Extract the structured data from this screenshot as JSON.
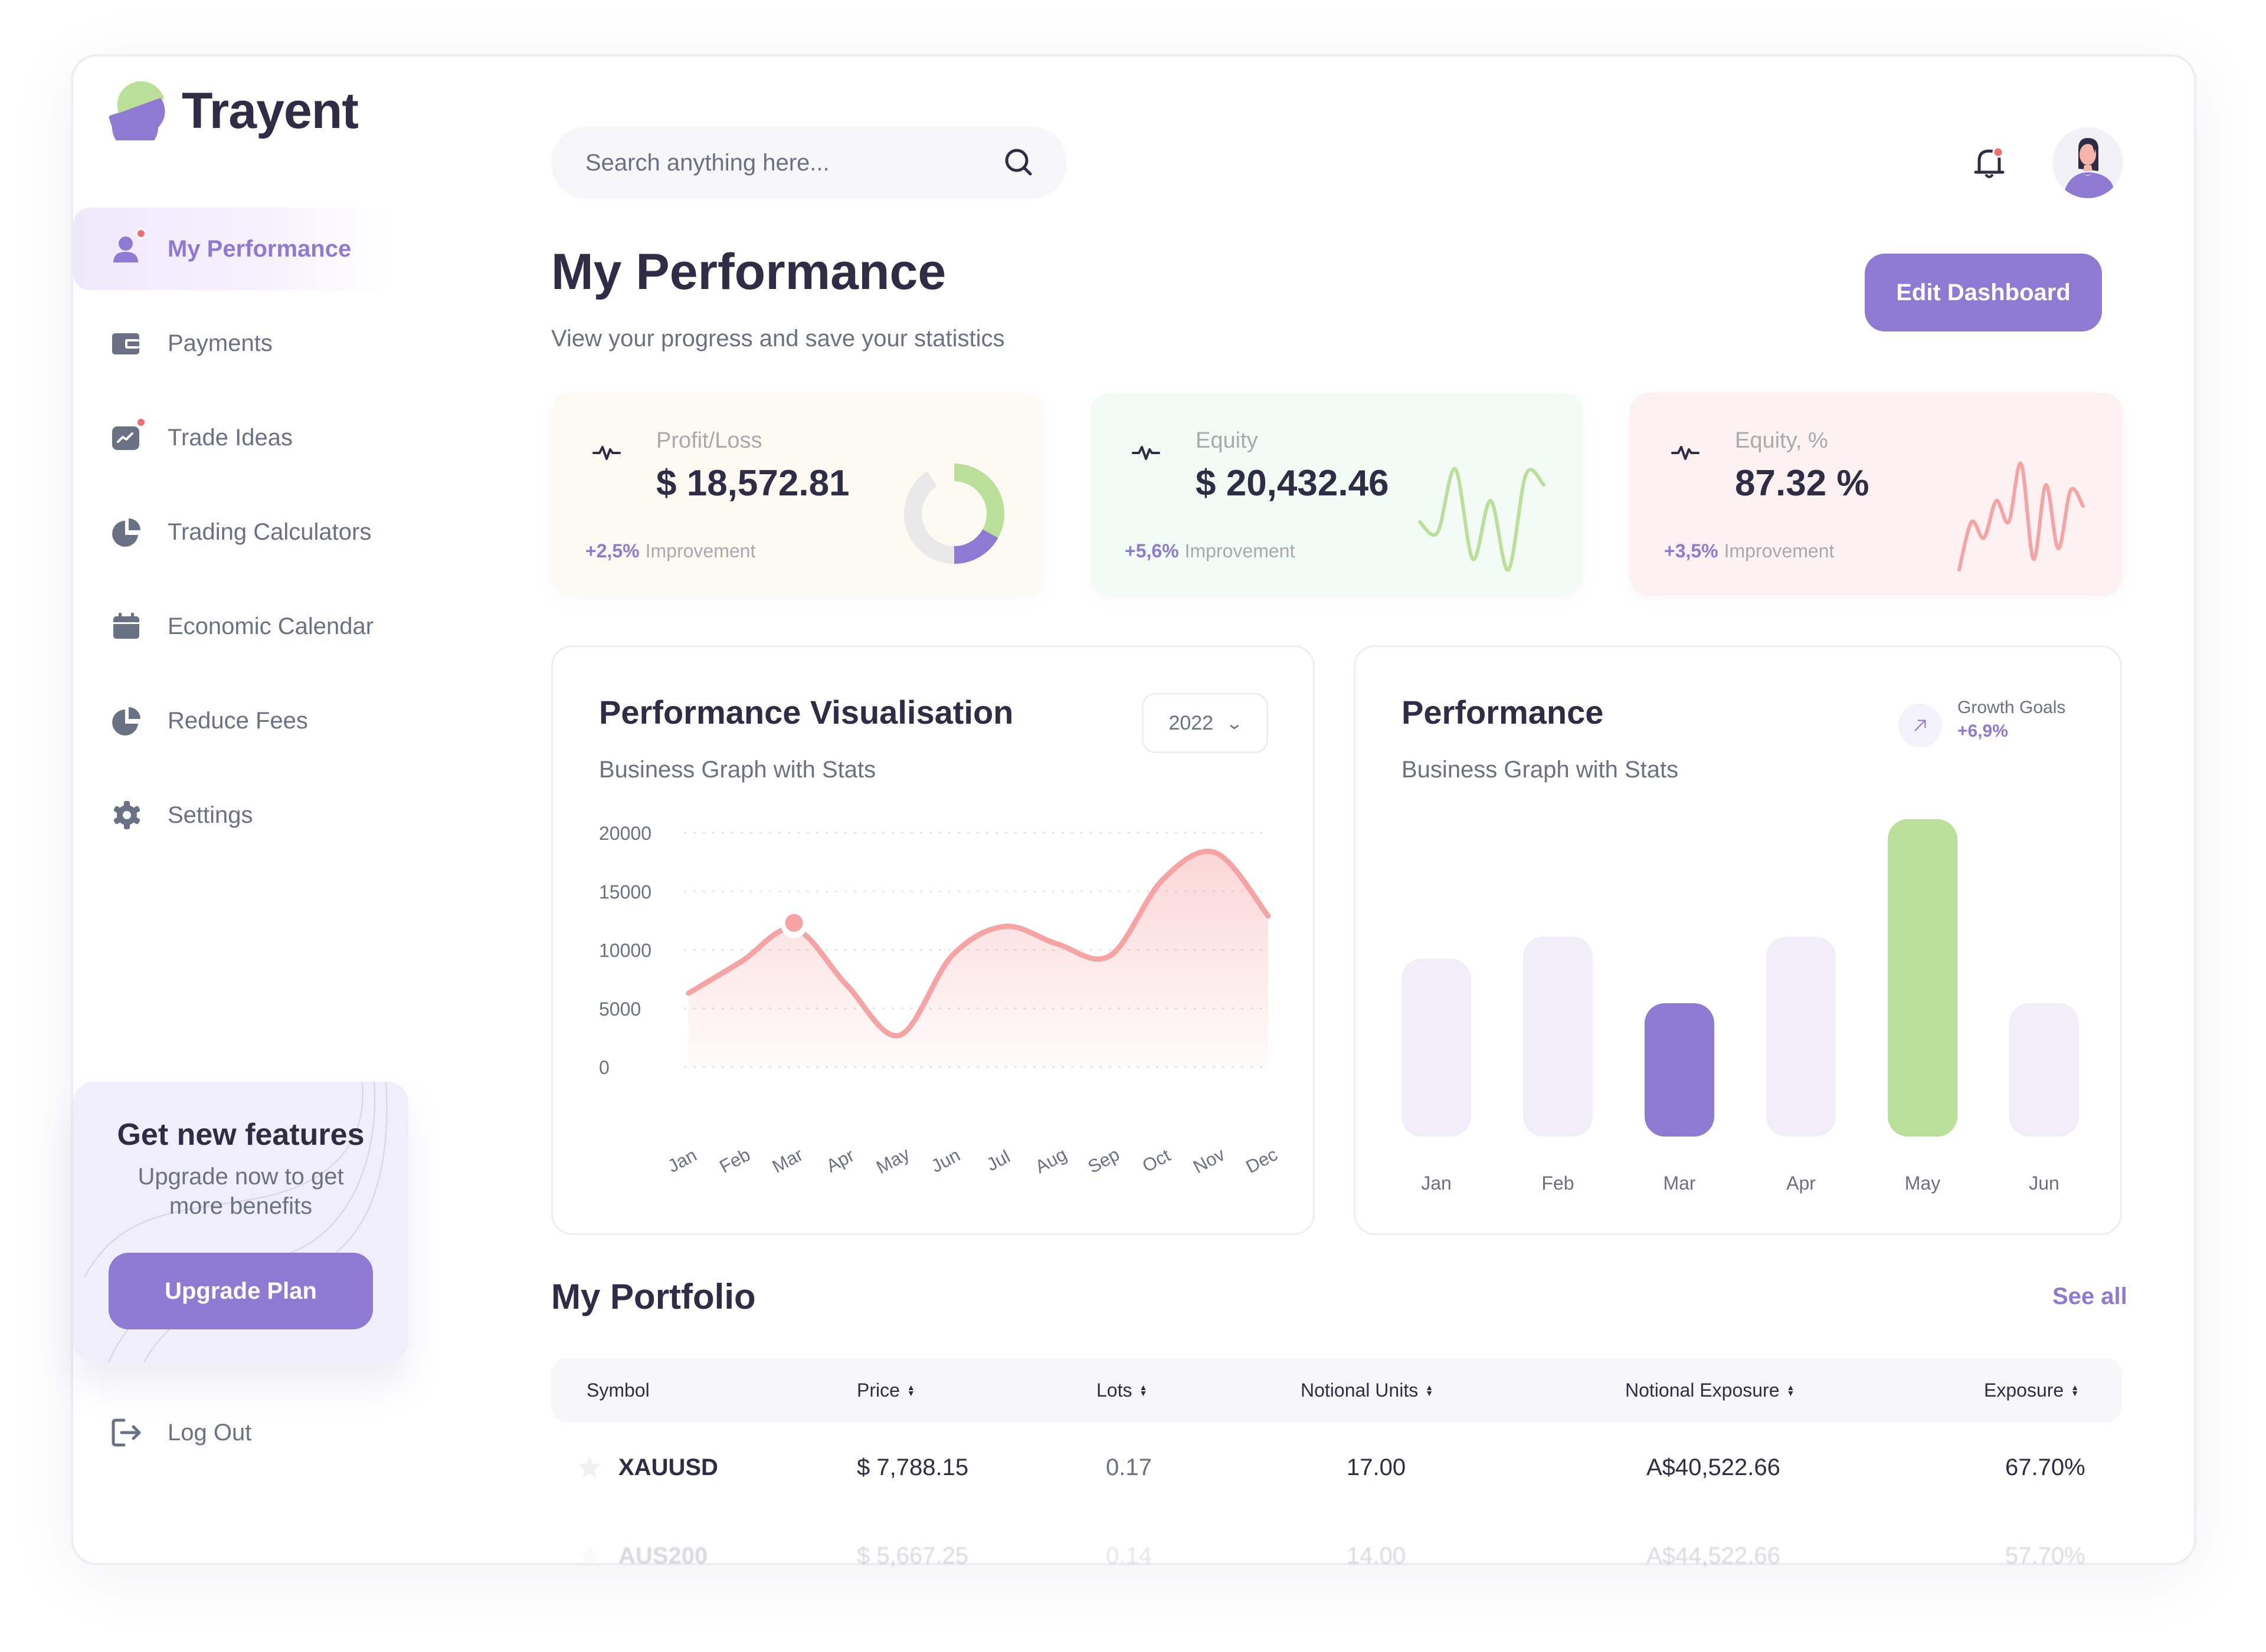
{
  "app": {
    "name": "Trayent"
  },
  "sidebar": {
    "items": [
      {
        "label": "My Performance",
        "icon": "user-icon",
        "active": true,
        "badge": true
      },
      {
        "label": "Payments",
        "icon": "wallet-icon",
        "active": false,
        "badge": false
      },
      {
        "label": "Trade Ideas",
        "icon": "chart-icon",
        "active": false,
        "badge": true
      },
      {
        "label": "Trading Calculators",
        "icon": "pie-chart-icon",
        "active": false,
        "badge": false
      },
      {
        "label": "Economic Calendar",
        "icon": "calendar-icon",
        "active": false,
        "badge": false
      },
      {
        "label": "Reduce Fees",
        "icon": "pie-chart-icon",
        "active": false,
        "badge": false
      },
      {
        "label": "Settings",
        "icon": "gear-icon",
        "active": false,
        "badge": false
      }
    ],
    "promo": {
      "title": "Get new features",
      "subtitle": "Upgrade now to get more benefits",
      "button": "Upgrade Plan"
    },
    "logout": "Log Out"
  },
  "header": {
    "search_placeholder": "Search anything here...",
    "search_value": "",
    "notifications_badge": true
  },
  "page": {
    "title": "My Performance",
    "subtitle": "View your progress and save your statistics",
    "edit_button": "Edit Dashboard"
  },
  "stats": [
    {
      "label": "Profit/Loss",
      "value": "$ 18,572.81",
      "delta": "+2,5%",
      "delta_label": "Improvement",
      "graph": "donut",
      "donut_fractions": {
        "green": 0.42,
        "purple": 0.17,
        "gray": 0.41
      }
    },
    {
      "label": "Equity",
      "value": "$ 20,432.46",
      "delta": "+5,6%",
      "delta_label": "Improvement",
      "graph": "sparkline",
      "color": "#b9df98",
      "spark": [
        0.45,
        0.35,
        0.95,
        0.1,
        0.65,
        0.0,
        0.9,
        0.8
      ]
    },
    {
      "label": "Equity, %",
      "value": "87.32 %",
      "delta": "+3,5%",
      "delta_label": "Improvement",
      "graph": "sparkline",
      "color": "#f6a3a3",
      "spark": [
        0.0,
        0.45,
        0.3,
        0.65,
        0.45,
        1.0,
        0.1,
        0.8,
        0.2,
        0.75,
        0.6
      ]
    }
  ],
  "colors": {
    "accent": "#8e7ad2",
    "green": "#b9df98",
    "pink": "#f6a3a3",
    "dark": "#2f2c45",
    "muted": "#6b7184",
    "bar_light": "#f1eefa"
  },
  "performance_visualisation": {
    "title": "Performance Visualisation",
    "subtitle": "Business Graph with Stats",
    "year_selected": "2022"
  },
  "performance_bars": {
    "title": "Performance",
    "subtitle": "Business Graph with Stats",
    "growth_label": "Growth Goals",
    "growth_value": "+6,9%"
  },
  "chart_data": [
    {
      "type": "area",
      "title": "Performance Visualisation",
      "subtitle": "Business Graph with Stats",
      "categories": [
        "Jan",
        "Feb",
        "Mar",
        "Apr",
        "May",
        "Jun",
        "Jul",
        "Aug",
        "Sep",
        "Oct",
        "Nov",
        "Dec"
      ],
      "values": [
        6300,
        9000,
        11800,
        7000,
        2700,
        9500,
        12000,
        10500,
        9500,
        16000,
        18300,
        12900
      ],
      "highlight_index": 2,
      "yticks": [
        0,
        5000,
        10000,
        15000,
        20000
      ],
      "ylim": [
        0,
        20000
      ],
      "xlabel": "",
      "ylabel": "",
      "grid": true,
      "color": "#f6a3a3"
    },
    {
      "type": "bar",
      "title": "Performance",
      "subtitle": "Business Graph with Stats",
      "categories": [
        "Jan",
        "Feb",
        "Mar",
        "Apr",
        "May",
        "Jun"
      ],
      "values": [
        56,
        63,
        42,
        63,
        100,
        42
      ],
      "value_units": "relative (% of May)",
      "highlight": {
        "Mar": "#8e7ad2",
        "May": "#b9df98"
      },
      "base_color": "#f1eefa",
      "grid": false
    }
  ],
  "portfolio": {
    "title": "My Portfolio",
    "see_all": "See all",
    "columns": [
      {
        "label": "Symbol",
        "sortable": false
      },
      {
        "label": "Price",
        "sortable": true
      },
      {
        "label": "Lots",
        "sortable": true
      },
      {
        "label": "Notional Units",
        "sortable": true
      },
      {
        "label": "Notional Exposure",
        "sortable": true
      },
      {
        "label": "Exposure",
        "sortable": true
      }
    ],
    "rows": [
      {
        "symbol": "XAUUSD",
        "price": "$ 7,788.15",
        "lots": "0.17",
        "units": "17.00",
        "notional": "A$40,522.66",
        "exposure": "67.70%"
      },
      {
        "symbol": "AUS200",
        "price": "$ 5,667.25",
        "lots": "0.14",
        "units": "14.00",
        "notional": "A$44,522.66",
        "exposure": "57.70%"
      }
    ]
  }
}
